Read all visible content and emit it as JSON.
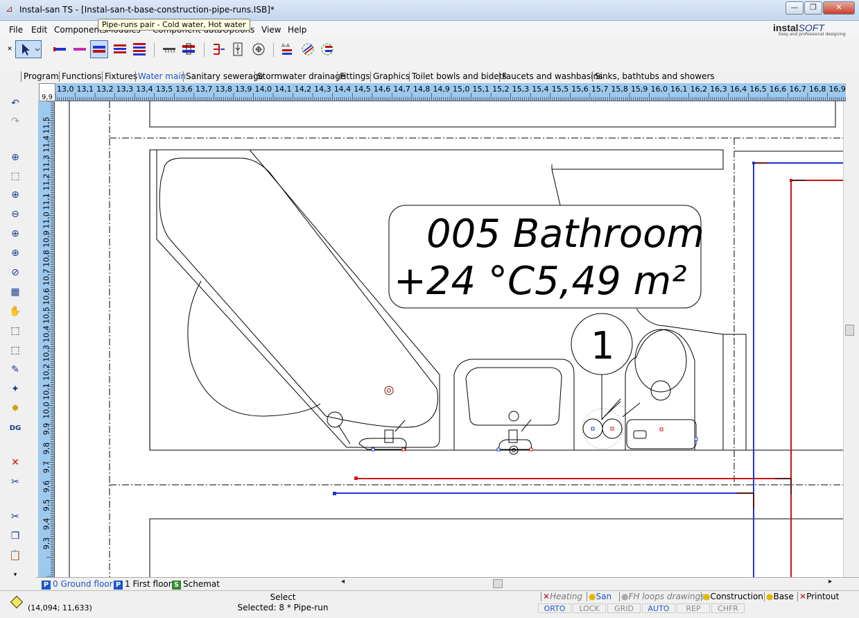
{
  "window": {
    "title": "Instal-san TS - [Instal-san-t-base-construction-pipe-runs.ISB]*"
  },
  "brand": {
    "name_a": "instal",
    "name_b": "SOFT",
    "tagline": "Easy and professional designing"
  },
  "menu": [
    "File",
    "Edit",
    "Components",
    "Modules",
    "Component data",
    "Options",
    "View",
    "Help"
  ],
  "tooltip": "Pipe-runs pair - Cold water, Hot water",
  "tabs": [
    {
      "label": "Program"
    },
    {
      "label": "Functions"
    },
    {
      "label": "Fixtures"
    },
    {
      "label": "Water main",
      "active": true
    },
    {
      "label": "Sanitary sewerage"
    },
    {
      "label": "Stormwater drainage"
    },
    {
      "label": "Fittings"
    },
    {
      "label": "Graphics"
    },
    {
      "label": "Toilet bowls and bidets"
    },
    {
      "label": "Faucets and washbasins"
    },
    {
      "label": "Sinks, bathtubs and showers"
    }
  ],
  "ruler": {
    "corner": "9,9",
    "h": [
      "13,0",
      "13,1",
      "13,2",
      "13,3",
      "13,4",
      "13,5",
      "13,6",
      "13,7",
      "13,8",
      "13,9",
      "14,0",
      "14,1",
      "14,2",
      "14,3",
      "14,4",
      "14,5",
      "14,6",
      "14,7",
      "14,8",
      "14,9",
      "15,0",
      "15,1",
      "15,2",
      "15,3",
      "15,4",
      "15,5",
      "15,6",
      "15,7",
      "15,8",
      "15,9",
      "16,0",
      "16,1",
      "16,2",
      "16,3",
      "16,4",
      "16,5",
      "16,6",
      "16,7",
      "16,8",
      "16,9"
    ],
    "v": [
      "11,5",
      "11,4",
      "11,3",
      "11,2",
      "11,1",
      "11,0",
      "10,9",
      "10,8",
      "10,7",
      "10,6",
      "10,5",
      "10,4",
      "10,3",
      "10,2",
      "10,1",
      "10,0",
      "9,9",
      "9,8",
      "9,7",
      "9,6",
      "9,5",
      "9,4",
      "9,3"
    ]
  },
  "drawing": {
    "room_name": "005 Bathroom",
    "room_info": "+24 °C5,49 m²",
    "fixture_number": "1",
    "colors": {
      "cold_water": "#1f33d6",
      "hot_water": "#d01010",
      "lines": "#000000"
    }
  },
  "sheets": [
    {
      "badge": "P",
      "label": "0 Ground floor",
      "active": true
    },
    {
      "badge": "P",
      "label": "1 First floor"
    },
    {
      "badge": "S",
      "label": "Schemat"
    }
  ],
  "status": {
    "coords": "(14,094; 11,633)",
    "mode": "Select",
    "selection": "Selected: 8 * Pipe-run"
  },
  "layers": [
    "Heating",
    "San",
    "FH loops drawings",
    "Construction",
    "Base",
    "Printout"
  ],
  "toggles": [
    {
      "label": "ORTO",
      "on": true
    },
    {
      "label": "LOCK",
      "on": false
    },
    {
      "label": "GRID",
      "on": false
    },
    {
      "label": "AUTO",
      "on": true
    },
    {
      "label": "REP",
      "on": false
    },
    {
      "label": "CHFR",
      "on": false
    }
  ]
}
